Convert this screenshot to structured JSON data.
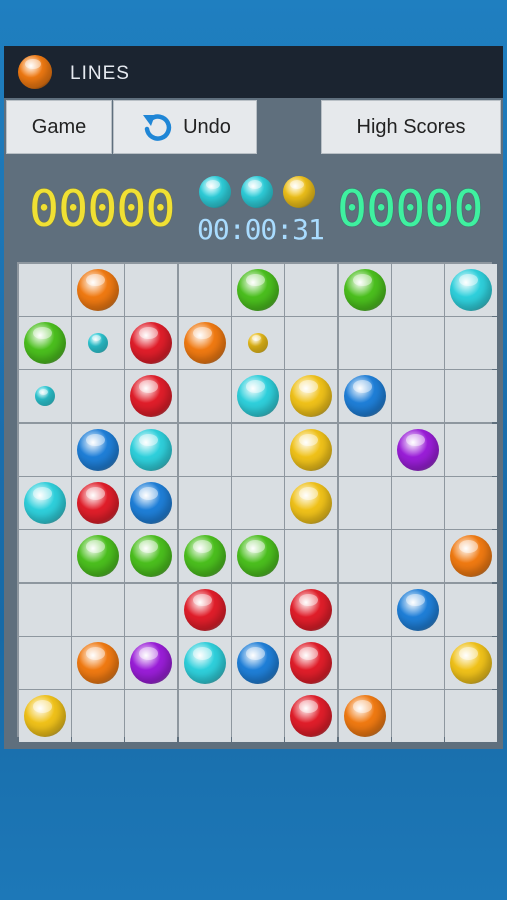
{
  "app": {
    "title": "LINES",
    "logo_icon": "orange-ball-icon"
  },
  "toolbar": {
    "game_label": "Game",
    "undo_label": "Undo",
    "undo_icon": "undo-arrow-icon",
    "high_scores_label": "High Scores"
  },
  "score": {
    "player": "00000",
    "high": "00000",
    "timer": "00:00:31"
  },
  "next_balls": [
    "cyan",
    "cyan",
    "yellow"
  ],
  "colors": {
    "orange": "#f07a12",
    "green": "#4bbf1e",
    "cyan": "#2fd0dc",
    "red": "#e01e2a",
    "blue": "#1f7fd8",
    "yellow": "#f0c21a",
    "purple": "#9a1ed8"
  },
  "board": [
    [
      "",
      "orange",
      "",
      "",
      "green",
      "",
      "green",
      "",
      "cyan"
    ],
    [
      "green",
      "cyan-small",
      "red",
      "orange",
      "yellow-small",
      "",
      "",
      "",
      ""
    ],
    [
      "cyan-small",
      "",
      "red",
      "",
      "cyan",
      "yellow",
      "blue",
      "",
      ""
    ],
    [
      "",
      "blue",
      "cyan",
      "",
      "",
      "yellow",
      "",
      "purple",
      ""
    ],
    [
      "cyan",
      "red",
      "blue",
      "",
      "",
      "yellow",
      "",
      "",
      ""
    ],
    [
      "",
      "green",
      "green",
      "green",
      "green",
      "",
      "",
      "",
      "orange"
    ],
    [
      "",
      "",
      "",
      "red",
      "",
      "red",
      "",
      "blue",
      ""
    ],
    [
      "",
      "orange",
      "purple",
      "cyan",
      "blue",
      "red",
      "",
      "",
      "yellow"
    ],
    [
      "yellow",
      "",
      "",
      "",
      "",
      "red",
      "orange",
      "",
      ""
    ]
  ]
}
